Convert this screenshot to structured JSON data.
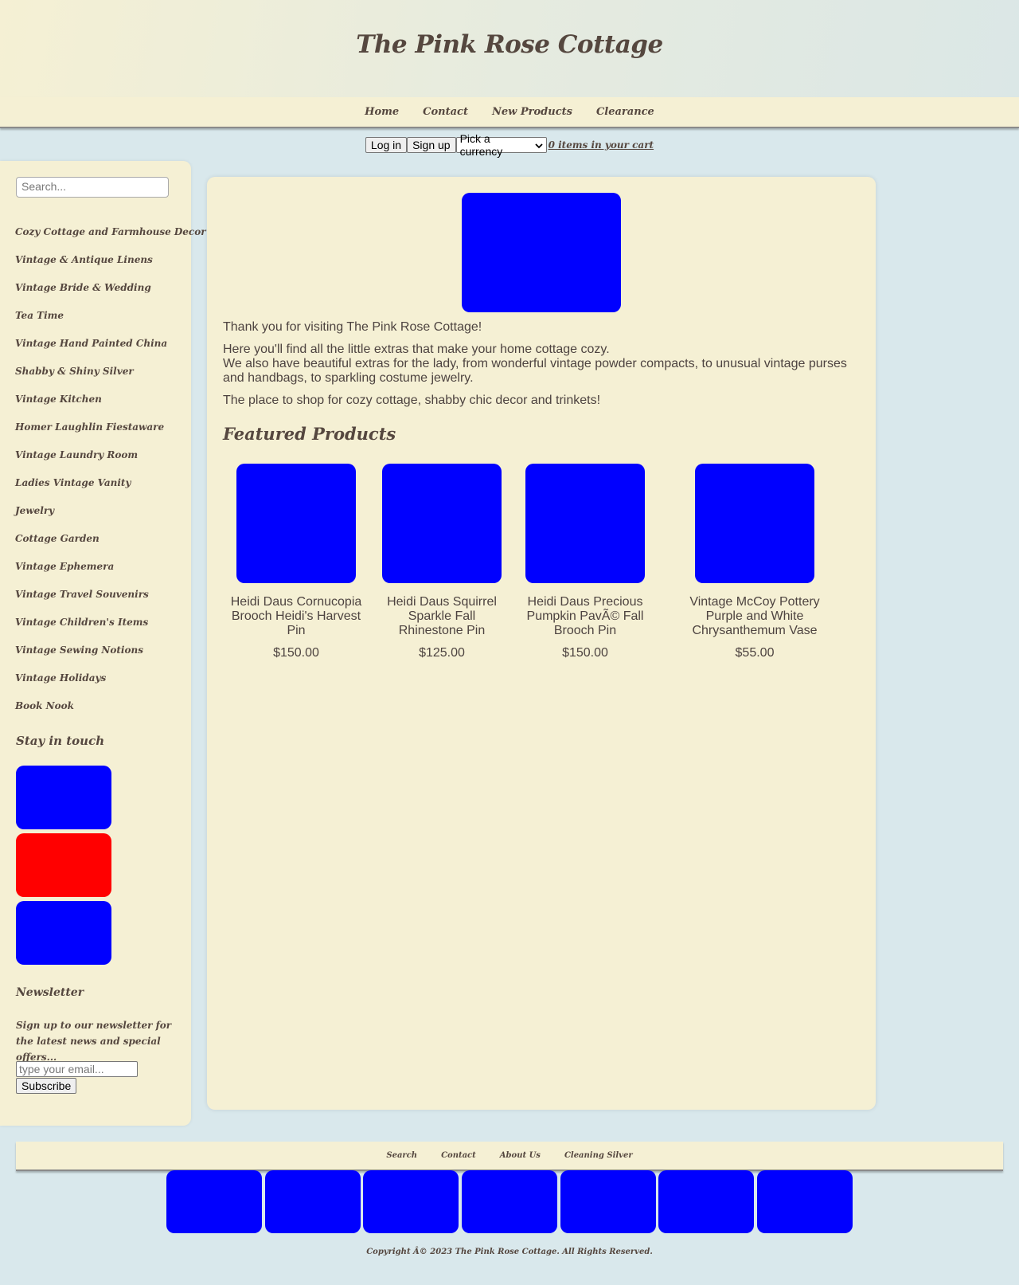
{
  "site": {
    "title": "The Pink Rose Cottage"
  },
  "topnav": [
    "Home",
    "Contact",
    "New Products",
    "Clearance"
  ],
  "utility": {
    "login_label": "Log in",
    "signup_label": "Sign up",
    "currency_selected": "Pick a currency",
    "cart_text": "0 items in your cart"
  },
  "sidebar": {
    "search_placeholder": "Search...",
    "categories": [
      "Cozy Cottage and Farmhouse Decor",
      "Vintage & Antique Linens",
      "Vintage Bride & Wedding",
      "Tea Time",
      "Vintage Hand Painted China",
      "Shabby & Shiny Silver",
      "Vintage Kitchen",
      "Homer Laughlin Fiestaware",
      "Vintage Laundry Room",
      "Ladies Vintage Vanity",
      "Jewelry",
      "Cottage Garden",
      "Vintage Ephemera",
      "Vintage Travel Souvenirs",
      "Vintage Children's Items",
      "Vintage Sewing Notions",
      "Vintage Holidays",
      "Book Nook"
    ],
    "stay_in_touch": "Stay in touch",
    "social_colors": [
      "#0000ff",
      "#ff0000",
      "#0000ff"
    ],
    "newsletter_title": "Newsletter",
    "newsletter_text": "Sign up to our newsletter for the latest news and special offers...",
    "email_placeholder": "type your email...",
    "subscribe_label": "Subscribe"
  },
  "main": {
    "intro": [
      "Thank you for visiting The Pink Rose Cottage!",
      "Here you'll find all the little extras that make your home cottage cozy.",
      "We also have beautiful extras for the lady, from wonderful vintage powder compacts, to unusual vintage purses and handbags, to sparkling costume jewelry.",
      "The place to shop for cozy cottage, shabby chic decor and trinkets!"
    ],
    "featured_title": "Featured Products",
    "products": [
      {
        "name": "Heidi Daus Cornucopia Brooch Heidi's Harvest Pin",
        "price": "$150.00"
      },
      {
        "name": "Heidi Daus Squirrel Sparkle Fall Rhinestone Pin",
        "price": "$125.00"
      },
      {
        "name": "Heidi Daus Precious Pumpkin PavÃ© Fall Brooch Pin",
        "price": "$150.00"
      },
      {
        "name": "Vintage McCoy Pottery Purple and White Chrysanthemum Vase",
        "price": "$55.00"
      }
    ]
  },
  "footer": {
    "nav": [
      "Search",
      "Contact",
      "About Us",
      "Cleaning Silver"
    ],
    "copyright": "Copyright Â© 2023 The Pink Rose Cottage. All Rights Reserved."
  },
  "colors": {
    "page_bg": "#d9e8ec",
    "panel_bg": "#f5f0d4",
    "text": "#55473f",
    "placeholder_blue": "#0000ff",
    "placeholder_red": "#ff0000"
  }
}
